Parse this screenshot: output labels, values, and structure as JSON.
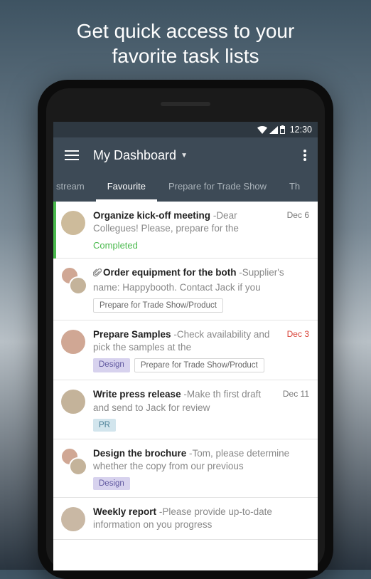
{
  "marketing": {
    "line1": "Get quick access to your",
    "line2": "favorite task lists"
  },
  "status": {
    "time": "12:30"
  },
  "header": {
    "title": "My Dashboard"
  },
  "tabs": [
    {
      "label": "stream",
      "partial": "left"
    },
    {
      "label": "Favourite",
      "active": true
    },
    {
      "label": "Prepare for Trade Show"
    },
    {
      "label": "Th",
      "partial": "right"
    }
  ],
  "tasks": [
    {
      "title": "Organize kick-off meeting",
      "sub": "Dear Collegues! Please, prepare for the",
      "date": "Dec 6",
      "completed": true,
      "completed_label": "Completed",
      "stripe": true,
      "avatars": 1
    },
    {
      "title": "Order equipment for the both",
      "sub": "Supplier's name: Happybooth. Contact Jack if you",
      "attach": true,
      "chips": [
        {
          "text": "Prepare for Trade Show/Product",
          "style": "outline"
        }
      ],
      "avatars": 2
    },
    {
      "title": "Prepare Samples",
      "sub": "Check availability and pick the samples at the",
      "date": "Dec 3",
      "date_red": true,
      "chips": [
        {
          "text": "Design",
          "style": "purple"
        },
        {
          "text": "Prepare for Trade Show/Product",
          "style": "outline"
        }
      ],
      "avatars": 1
    },
    {
      "title": "Write press release",
      "sub": "Make th first draft and send to Jack for review",
      "date": "Dec 11",
      "chips": [
        {
          "text": "PR",
          "style": "blue"
        }
      ],
      "avatars": 1
    },
    {
      "title": "Design the brochure",
      "sub": "Tom, please determine whether the copy from our previous",
      "chips": [
        {
          "text": "Design",
          "style": "purple"
        }
      ],
      "avatars": 2
    },
    {
      "title": "Weekly report",
      "sub": "Please provide up-to-date information on you progress",
      "avatars": 1
    }
  ]
}
